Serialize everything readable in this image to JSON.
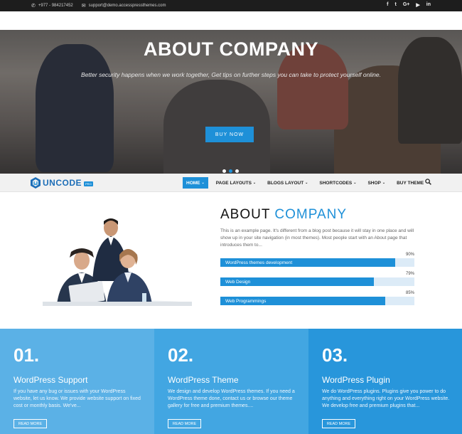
{
  "topbar": {
    "phone": "+977 - 984217452",
    "email": "support@demo.accesspressthemes.com",
    "social": [
      "f",
      "t",
      "G+",
      "▶",
      "in"
    ]
  },
  "hero": {
    "title": "ABOUT COMPANY",
    "subtitle": "Better security happens when we work together, Get tips on further steps you can take to protect yourself online.",
    "button": "BUY NOW",
    "slides_count": 3,
    "active_slide": 1
  },
  "nav": {
    "logo_text": "UNCODE",
    "logo_badge": "PRO",
    "items": [
      {
        "label": "HOME",
        "caret": "⌄",
        "active": true
      },
      {
        "label": "PAGE LAYOUTS",
        "caret": "⌄",
        "active": false
      },
      {
        "label": "BLOGS LAYOUT",
        "caret": "⌄",
        "active": false
      },
      {
        "label": "SHORTCODES",
        "caret": "⌄",
        "active": false
      },
      {
        "label": "SHOP",
        "caret": "⌄",
        "active": false
      },
      {
        "label": "BUY THEME",
        "caret": "",
        "active": false
      }
    ],
    "search_icon": "search-icon"
  },
  "about": {
    "title_a": "ABOUT",
    "title_b": "COMPANY",
    "text": "This is an example page. It's different from a blog post because it will stay in one place and will show up in your site navigation (in most themes). Most people start with an About page that introduces them to...",
    "skills": [
      {
        "label": "WordPress themes development",
        "percent": 90,
        "percent_label": "90%"
      },
      {
        "label": "Web Design",
        "percent": 79,
        "percent_label": "79%"
      },
      {
        "label": "Web Programmings",
        "percent": 85,
        "percent_label": "85%"
      }
    ]
  },
  "features": [
    {
      "num": "01.",
      "title": "WordPress Support",
      "desc": "If you have any bug or issues with your WordPress website, let us know. We provide website support on fixed cost or monthly basis. We've...",
      "button": "READ MORE",
      "color": "#5bb1e6"
    },
    {
      "num": "02.",
      "title": "WordPress Theme",
      "desc": "We design and develop WordPress themes. If you need a WordPress theme done, contact us or browse our theme gallery for free and premium themes....",
      "button": "READ MORE",
      "color": "#42a6e2"
    },
    {
      "num": "03.",
      "title": "WordPress Plugin",
      "desc": "We do WordPress plugins. Plugins give you power to do anything and everything right on your WordPress website. We develop free and premium plugins that...",
      "button": "READ MORE",
      "color": "#2896db"
    }
  ],
  "colors": {
    "accent": "#1e90d8",
    "topbar": "#1d1d1d",
    "track": "#dcebf7"
  }
}
